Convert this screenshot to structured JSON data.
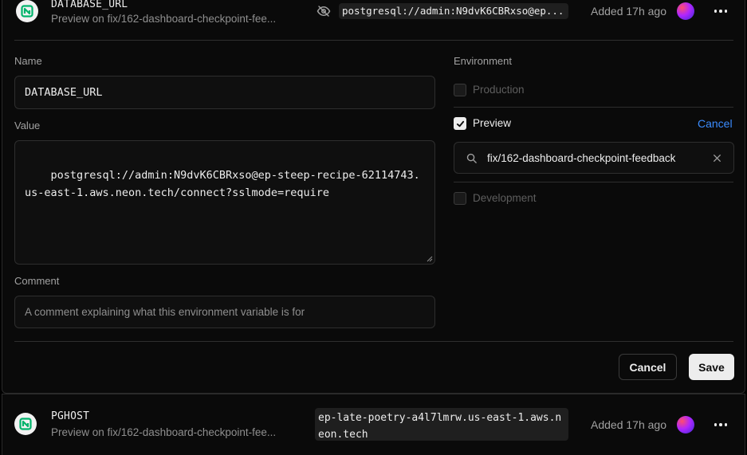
{
  "top_row": {
    "name": "DATABASE_URL",
    "subtitle": "Preview on fix/162-dashboard-checkpoint-fee...",
    "value_preview": "postgresql://admin:N9dvK6CBRxso@ep...",
    "added": "Added 17h ago",
    "icons": {
      "logo": "neon-logo-icon",
      "visibility": "eye-off-icon",
      "more": "more-horizontal-icon"
    }
  },
  "form": {
    "name_label": "Name",
    "name_value": "DATABASE_URL",
    "value_label": "Value",
    "value_text": "postgresql://admin:N9dvK6CBRxso@ep-steep-recipe-62114743.us-east-1.aws.neon.tech/connect?sslmode=require",
    "comment_label": "Comment",
    "comment_placeholder": "A comment explaining what this environment variable is for",
    "cancel_label": "Cancel",
    "save_label": "Save"
  },
  "environment": {
    "label": "Environment",
    "options": [
      {
        "label": "Production",
        "checked": false
      },
      {
        "label": "Preview",
        "checked": true
      },
      {
        "label": "Development",
        "checked": false
      }
    ],
    "cancel_link": "Cancel",
    "branch_search_value": "fix/162-dashboard-checkpoint-feedback"
  },
  "bottom_row": {
    "name": "PGHOST",
    "subtitle": "Preview on fix/162-dashboard-checkpoint-fee...",
    "value": "ep-late-poetry-a4l7lmrw.us-east-1.aws.neon.tech",
    "added": "Added 17h ago"
  },
  "colors": {
    "accent_link": "#3b8cff",
    "neon_green": "#00b36b",
    "background": "#0a0a0a"
  }
}
